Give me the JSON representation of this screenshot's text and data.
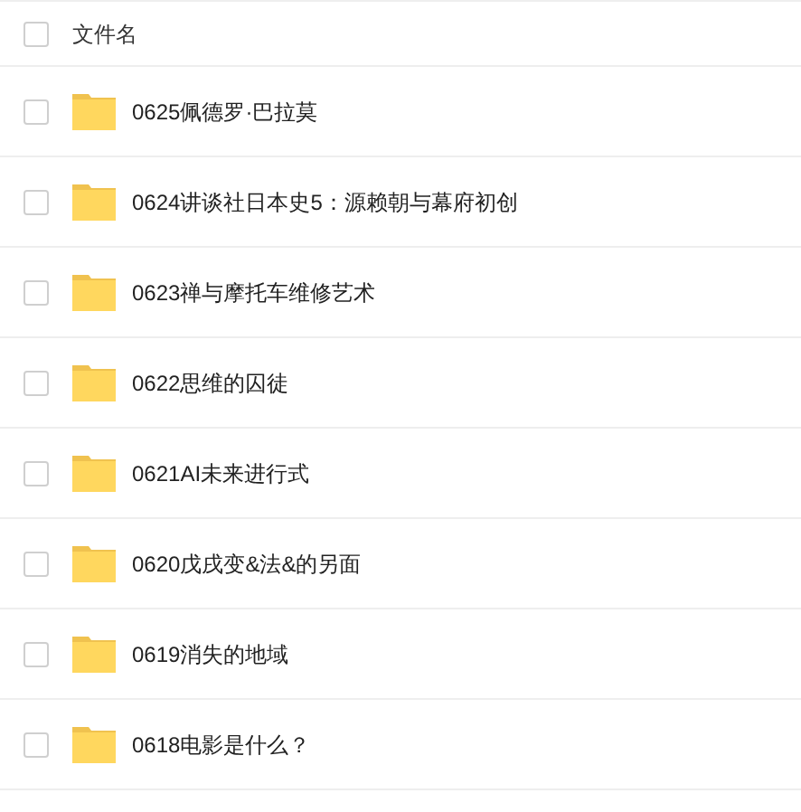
{
  "header": {
    "checked": false,
    "label": "文件名"
  },
  "rows": [
    {
      "name": "0625佩德罗·巴拉莫",
      "checked": false
    },
    {
      "name": "0624讲谈社日本史5：源赖朝与幕府初创",
      "checked": false
    },
    {
      "name": "0623禅与摩托车维修艺术",
      "checked": false
    },
    {
      "name": "0622思维的囚徒",
      "checked": false
    },
    {
      "name": "0621AI未来进行式",
      "checked": false
    },
    {
      "name": "0620戊戌变&法&的另面",
      "checked": false
    },
    {
      "name": "0619消失的地域",
      "checked": false
    },
    {
      "name": "0618电影是什么？",
      "checked": false
    }
  ]
}
